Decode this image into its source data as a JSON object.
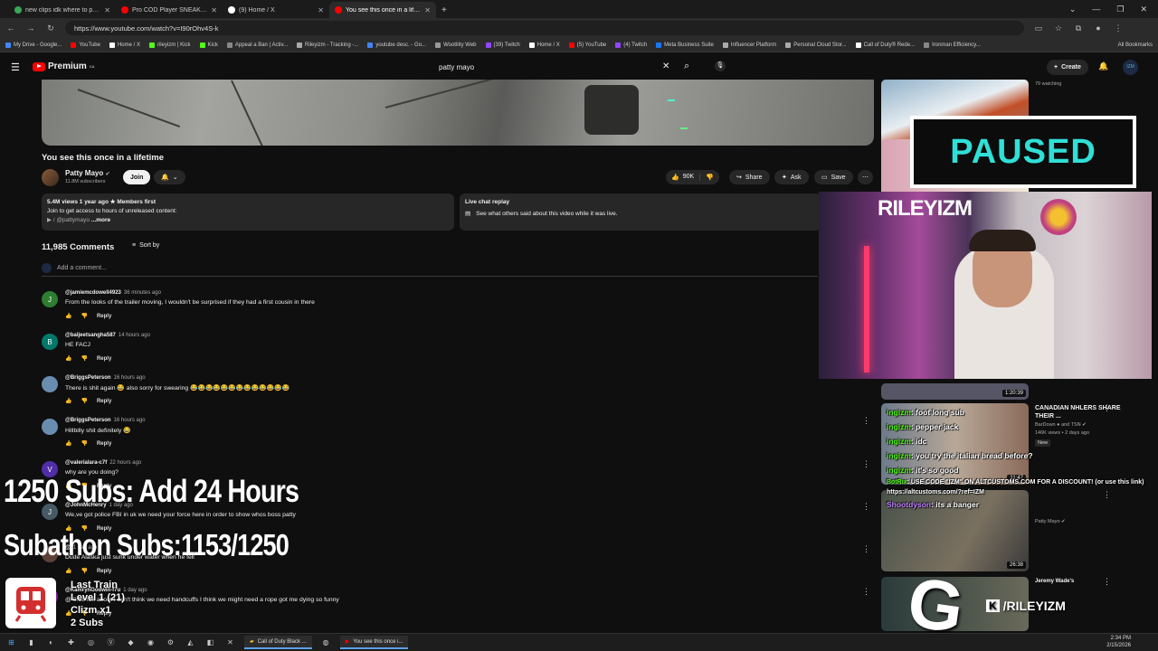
{
  "tabs": [
    {
      "label": "new clips idk where to put - Go",
      "color": "#3aa757",
      "active": false
    },
    {
      "label": "Pro COD Player SNEAKS into R",
      "color": "#ff0000",
      "active": false
    },
    {
      "label": "(9) Home / X",
      "color": "#ffffff",
      "active": false
    },
    {
      "label": "You see this once in a lifetin",
      "color": "#ff0000",
      "active": true
    }
  ],
  "omnibox": {
    "url": "https://www.youtube.com/watch?v=I90rOhv4S-k"
  },
  "bookmarks": [
    "My Drive - Google...",
    "YouTube",
    "Home / X",
    "rileyizm | Kick",
    "Kick",
    "Appeal a Ban | Activ...",
    "Rileyizm - Tracking -...",
    "youtube desc. - Go...",
    "Wootility Web",
    "(39) Twitch",
    "Home / X",
    "(5) YouTube",
    "(4) Twitch",
    "Meta Business Suite",
    "Influencer Platform",
    "Personal Cloud Stor...",
    "Call of Duty® Rede...",
    "Ironman Efficiency..."
  ],
  "all_bookmarks": "All Bookmarks",
  "yt": {
    "logo": "Premium",
    "logo_sup": "CA",
    "search_value": "patty mayo",
    "create_label": "Create",
    "avatar_label": "IZM"
  },
  "video": {
    "title": "You see this once in a lifetime"
  },
  "channel": {
    "name": "Patty Mayo",
    "subs": "11.8M subscribers",
    "join": "Join"
  },
  "actions": {
    "likes": "90K",
    "share": "Share",
    "ask": "Ask",
    "save": "Save"
  },
  "description": {
    "line1": "5.4M views  1 year ago  ★ Members first",
    "line2": "Join to get access to hours of unreleased content:",
    "line3": "@pattymayo",
    "more": "...more"
  },
  "livechat": {
    "title": "Live chat replay",
    "text": "See what others said about this video while it was live."
  },
  "comments_header": {
    "count": "11,985 Comments",
    "sort": "Sort by",
    "add": "Add a comment..."
  },
  "comments": [
    {
      "author": "@jamiemcdowell4923",
      "time": "36 minutes ago",
      "text": "From the looks of the trailer moving, I wouldn't be surprised if they had a first cousin in there",
      "initial": "J",
      "color": "#2e7d32"
    },
    {
      "author": "@baljeetsangha587",
      "time": "14 hours ago",
      "text": "HE FACJ",
      "initial": "B",
      "color": "#00796b"
    },
    {
      "author": "@BriggsPeterson",
      "time": "16 hours ago",
      "text": "There is shit again 😂 also sorry for swearing 😂😂😂😂😂😂😂😂😂😂😂😂😂",
      "initial": "",
      "color": "#6a8caf"
    },
    {
      "author": "@BriggsPeterson",
      "time": "16 hours ago",
      "text": "Hillbilly shit definitely 😂",
      "initial": "",
      "color": "#6a8caf"
    },
    {
      "author": "@valerialara-c7f",
      "time": "22 hours ago",
      "text": "why are you doing?",
      "initial": "V",
      "color": "#512da8"
    },
    {
      "author": "@JohnMcHenry",
      "time": "1 day ago",
      "text": "We,ve got police FBI in uk we need your force here in order to show whos boss patty",
      "initial": "J",
      "color": "#455a64"
    },
    {
      "author": "@",
      "time": "1 day ago",
      "text": "Dude Alaska just sunk under water when he fell",
      "initial": "",
      "color": "#5d4037"
    },
    {
      "author": "@KamrynGodwin-f7u",
      "time": "1 day ago",
      "text": "@ 8:58 Idk about I don't think we need handcuffs I think we might need a rope got me dying so funny",
      "initial": "K",
      "color": "#7b1fa2"
    }
  ],
  "reply_label": "Reply",
  "sidebar": {
    "watching": "79 watching",
    "cards": [
      {
        "title": "",
        "meta": "",
        "dur": "1:20:39"
      },
      {
        "title": "CANADIAN NHLERS SHARE THEIR ...",
        "channel": "BarDown ● and TSN ✔",
        "meta": "146K views • 2 days ago",
        "badge": "New",
        "dur": "11:47"
      },
      {
        "title": "",
        "channel": "Patty Mayo ✔",
        "meta": "",
        "dur": "26:38"
      },
      {
        "title": "Jeremy Wade's",
        "meta": "",
        "dur": ""
      }
    ]
  },
  "overlay": {
    "paused": "PAUSED",
    "cam_name": "RILEYIZM",
    "sub_goal": "1250 Subs: Add 24 Hours",
    "subathon": "Subathon Subs:1153/1250",
    "train": {
      "line1": "Last Train",
      "line2": "Level 1 (21)",
      "line3": "Clizm x1",
      "line4": "2 Subs"
    },
    "chat": [
      {
        "user": "ingizm",
        "msg": ": foot long sub"
      },
      {
        "user": "ingizm",
        "msg": ": pepper jack"
      },
      {
        "user": "ingizm",
        "msg": ": idc"
      },
      {
        "user": "ingizm",
        "msg": ": you try the italian bread before?"
      },
      {
        "user": "ingizm",
        "msg": ": it's so good"
      },
      {
        "user": "BotRix",
        "msg": ": USE CODE \"IZM\" ON ALTCUSTOMS.COM FOR A DISCOUNT! (or use this link) https://altcustoms.com/?ref=IZM"
      },
      {
        "user": "Shootdyson",
        "msg": ": its a banger"
      }
    ],
    "handle": "/RILEYIZM",
    "kick_letter": "K"
  },
  "taskbar": {
    "apps": [
      "Call of Duty Black ...",
      "You see this once i..."
    ],
    "time": "2:34 PM",
    "date": "2/15/2026"
  }
}
